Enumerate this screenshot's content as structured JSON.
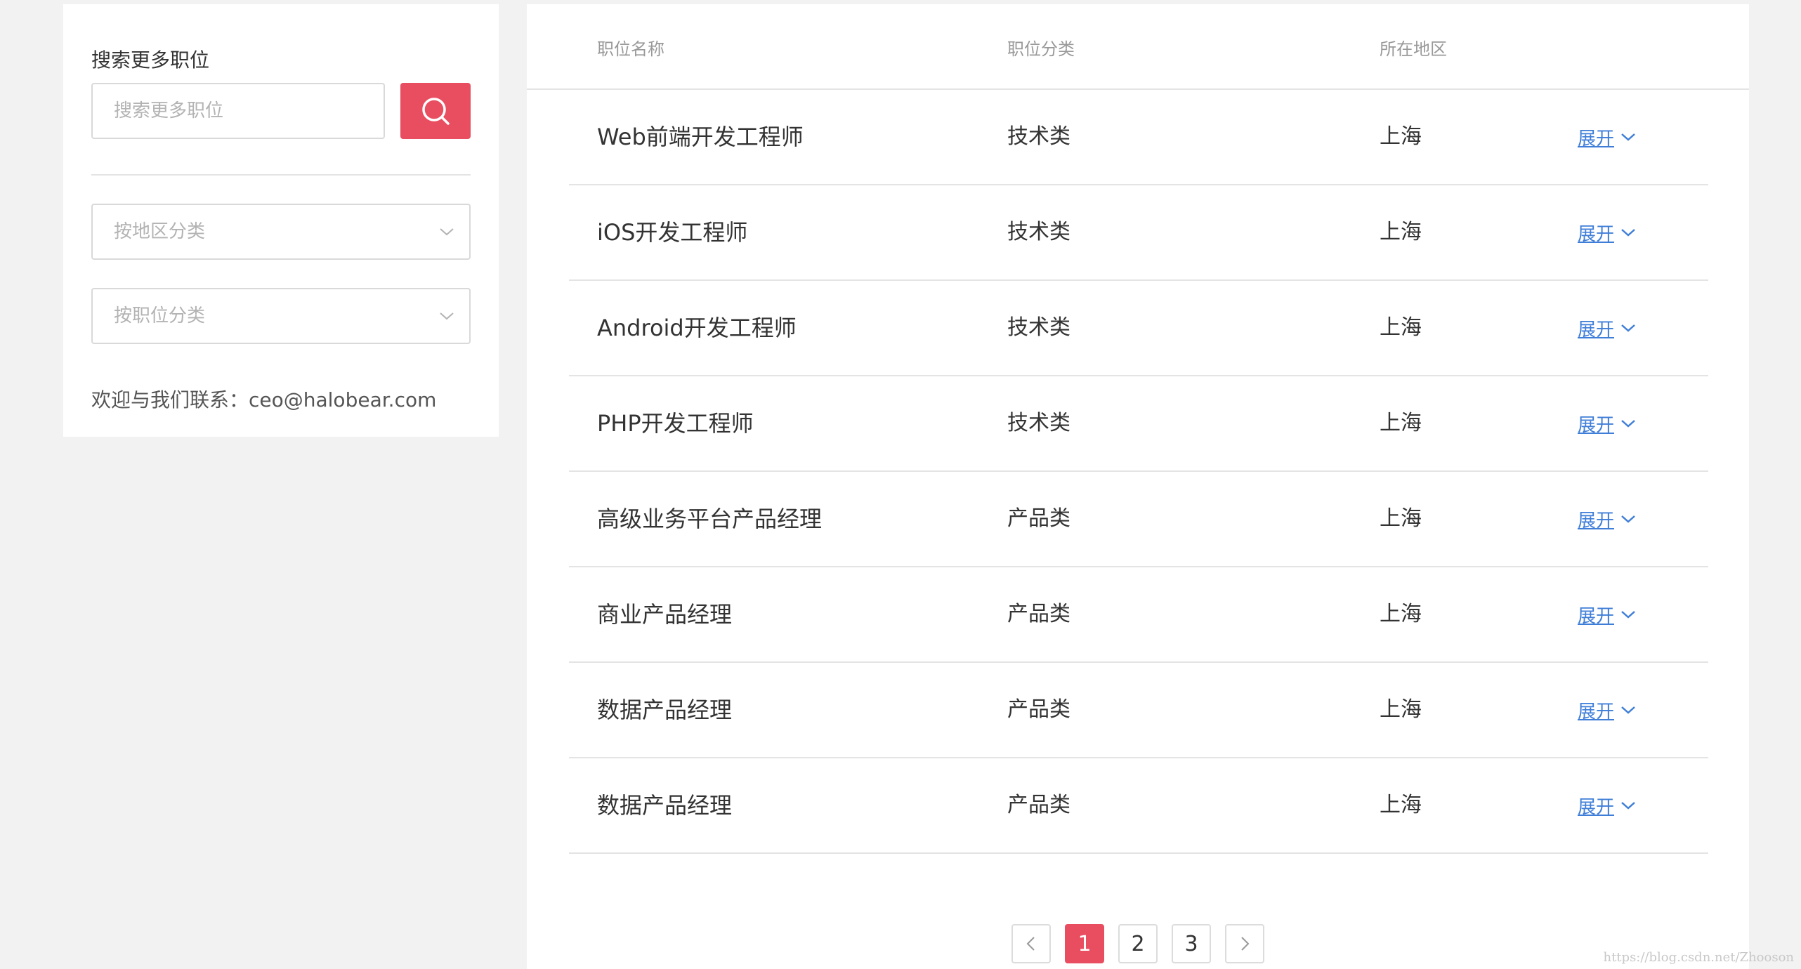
{
  "sidebar": {
    "title": "搜索更多职位",
    "search_placeholder": "搜索更多职位",
    "search_value": "",
    "search_icon": "search-icon",
    "region_select_label": "按地区分类",
    "position_select_label": "按职位分类",
    "contact_text": "欢迎与我们联系：ceo@halobear.com"
  },
  "table": {
    "headers": {
      "name": "职位名称",
      "category": "职位分类",
      "location": "所在地区"
    },
    "rows": [
      {
        "name": "Web前端开发工程师",
        "category": "技术类",
        "location": "上海",
        "action": "展开"
      },
      {
        "name": "iOS开发工程师",
        "category": "技术类",
        "location": "上海",
        "action": "展开"
      },
      {
        "name": "Android开发工程师",
        "category": "技术类",
        "location": "上海",
        "action": "展开"
      },
      {
        "name": "PHP开发工程师",
        "category": "技术类",
        "location": "上海",
        "action": "展开"
      },
      {
        "name": "高级业务平台产品经理",
        "category": "产品类",
        "location": "上海",
        "action": "展开"
      },
      {
        "name": "商业产品经理",
        "category": "产品类",
        "location": "上海",
        "action": "展开"
      },
      {
        "name": "数据产品经理",
        "category": "产品类",
        "location": "上海",
        "action": "展开"
      },
      {
        "name": "数据产品经理",
        "category": "产品类",
        "location": "上海",
        "action": "展开"
      }
    ]
  },
  "pagination": {
    "pages": [
      "1",
      "2",
      "3"
    ],
    "current": "1",
    "prev_icon": "chevron-left-icon",
    "next_icon": "chevron-right-icon"
  },
  "watermark": "https://blog.csdn.net/Zhooson",
  "colors": {
    "accent": "#e94d60",
    "link": "#3f7ed8",
    "background": "#f2f2f2"
  }
}
